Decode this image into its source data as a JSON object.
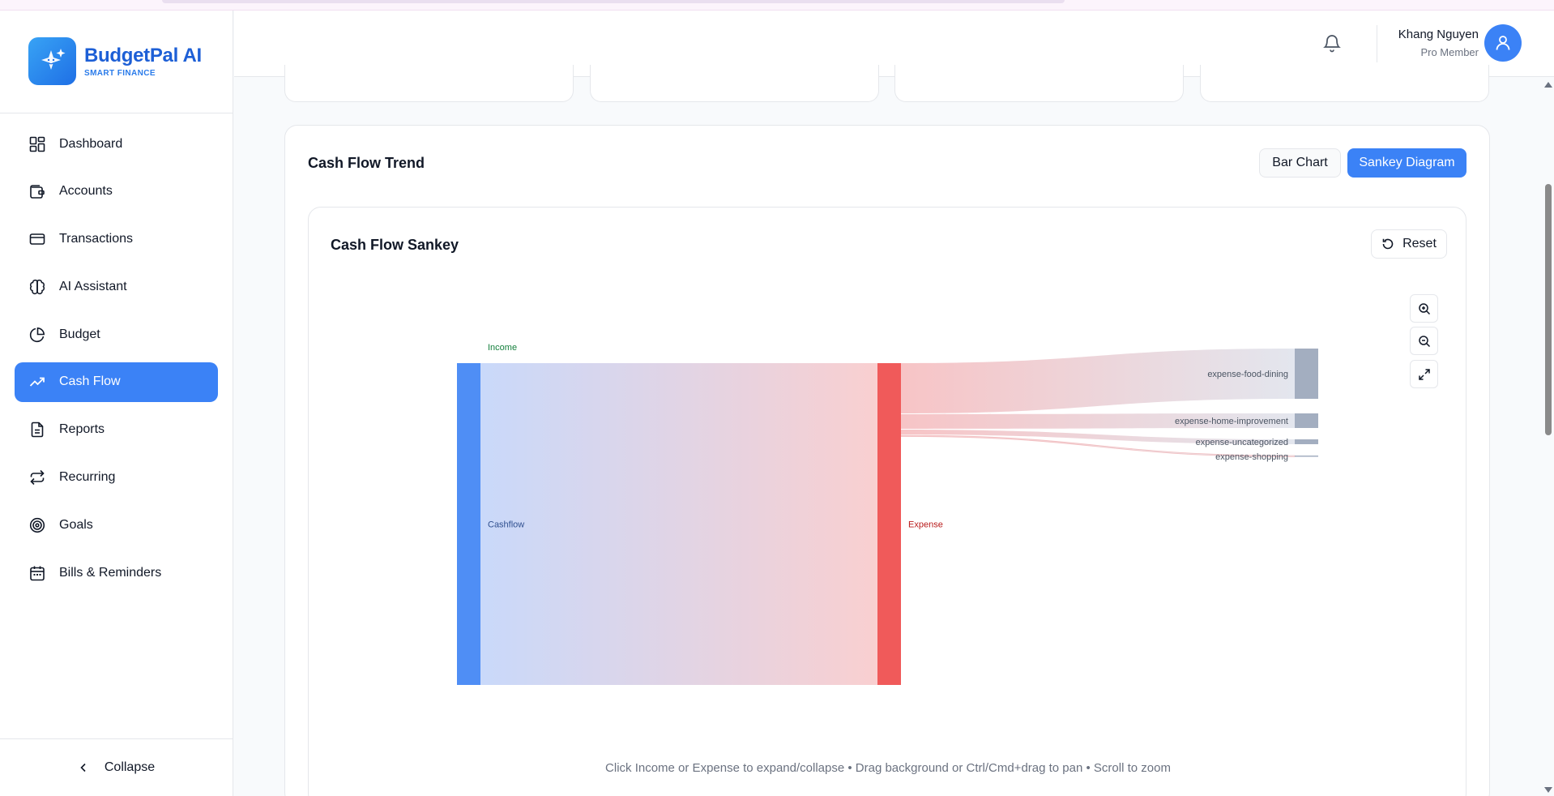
{
  "brand": {
    "name": "BudgetPal AI",
    "tagline": "SMART FINANCE"
  },
  "sidebar": {
    "items": [
      {
        "label": "Dashboard",
        "icon": "dashboard-icon"
      },
      {
        "label": "Accounts",
        "icon": "wallet-icon"
      },
      {
        "label": "Transactions",
        "icon": "credit-card-icon"
      },
      {
        "label": "AI Assistant",
        "icon": "brain-icon"
      },
      {
        "label": "Budget",
        "icon": "pie-chart-icon"
      },
      {
        "label": "Cash Flow",
        "icon": "trending-up-icon",
        "active": true
      },
      {
        "label": "Reports",
        "icon": "document-icon"
      },
      {
        "label": "Recurring",
        "icon": "repeat-icon"
      },
      {
        "label": "Goals",
        "icon": "target-icon"
      },
      {
        "label": "Bills & Reminders",
        "icon": "calendar-icon"
      }
    ],
    "collapse_label": "Collapse"
  },
  "header": {
    "user_name": "Khang Nguyen",
    "user_role": "Pro Member"
  },
  "panel": {
    "title": "Cash Flow Trend",
    "bar_chart_label": "Bar Chart",
    "sankey_label": "Sankey Diagram"
  },
  "sankey": {
    "title": "Cash Flow Sankey",
    "reset_label": "Reset",
    "hint": "Click Income or Expense to expand/collapse • Drag background or Ctrl/Cmd+drag to pan • Scroll to zoom",
    "nodes": {
      "income": "Income",
      "cashflow": "Cashflow",
      "expense": "Expense"
    },
    "expense_categories": [
      {
        "label": "expense-food-dining",
        "share": 0.62
      },
      {
        "label": "expense-home-improvement",
        "share": 0.18
      },
      {
        "label": "expense-uncategorized",
        "share": 0.06
      },
      {
        "label": "expense-shopping",
        "share": 0.01
      }
    ],
    "colors": {
      "income": "#4f8ef5",
      "expense": "#f05a5a",
      "category": "#a3aec0",
      "income_label": "#15803d",
      "expense_label": "#b91c1c"
    }
  }
}
